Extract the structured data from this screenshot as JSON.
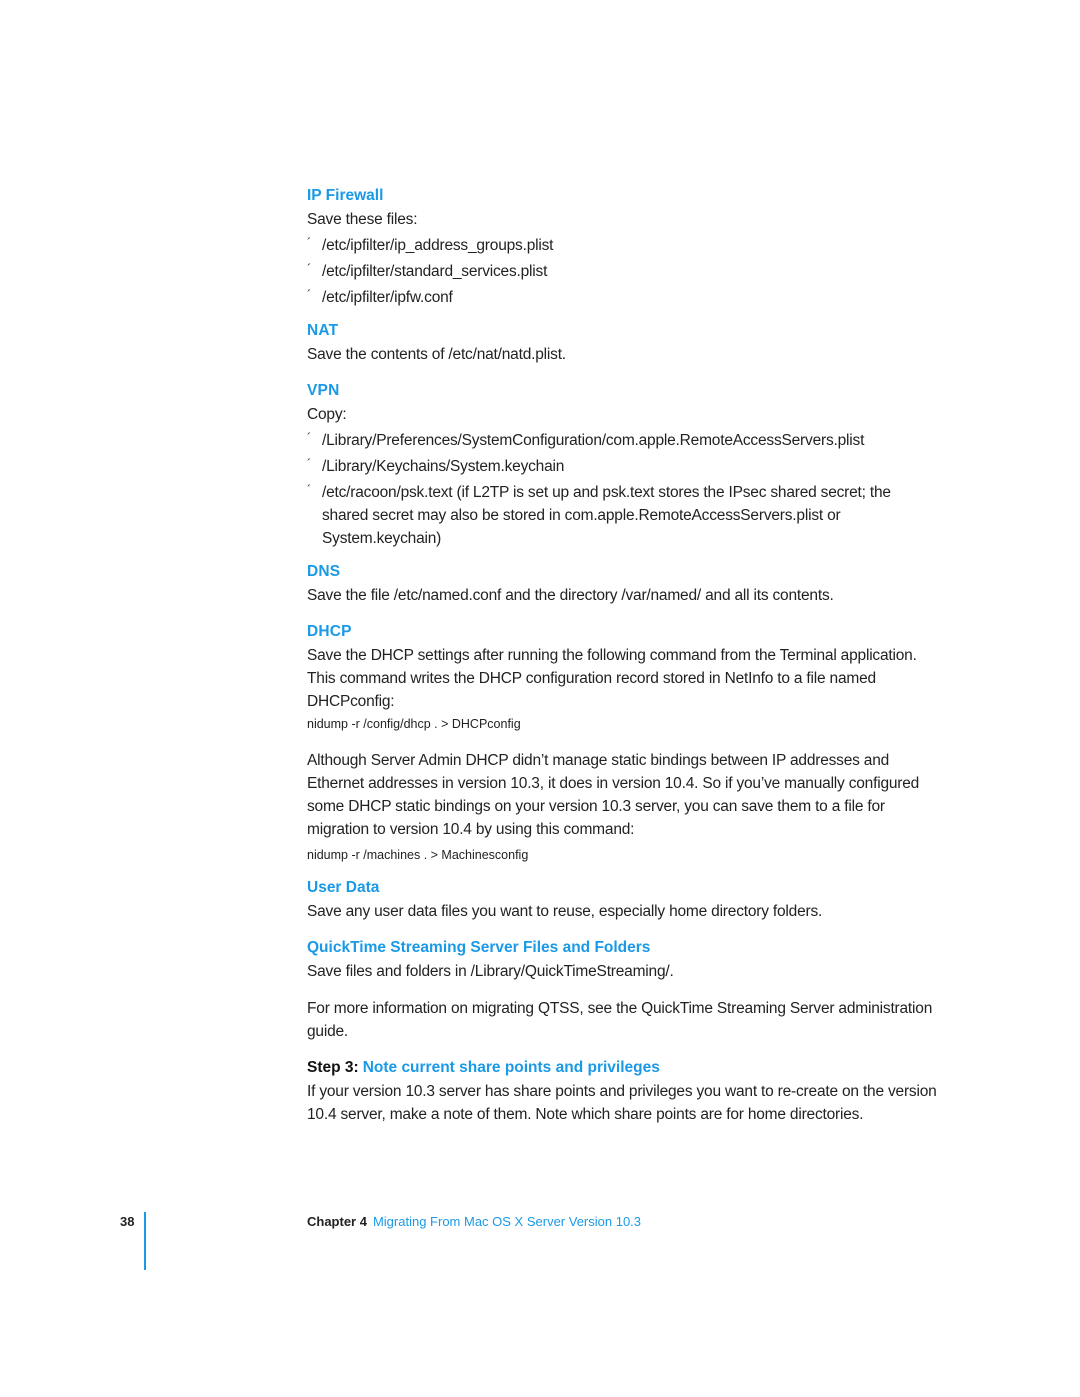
{
  "sections": {
    "ip_firewall": {
      "heading": "IP Firewall",
      "intro": "Save these files:",
      "items": [
        "/etc/ipfilter/ip_address_groups.plist",
        "/etc/ipfilter/standard_services.plist",
        "/etc/ipfilter/ipfw.conf"
      ]
    },
    "nat": {
      "heading": "NAT",
      "body": "Save the contents of /etc/nat/natd.plist."
    },
    "vpn": {
      "heading": "VPN",
      "intro": "Copy:",
      "items": [
        "/Library/Preferences/SystemConfiguration/com.apple.RemoteAccessServers.plist",
        "/Library/Keychains/System.keychain",
        "/etc/racoon/psk.text (if L2TP is set up and psk.text stores the IPsec shared secret; the shared secret may also be stored in com.apple.RemoteAccessServers.plist or System.keychain)"
      ]
    },
    "dns": {
      "heading": "DNS",
      "body": "Save the file /etc/named.conf and the directory /var/named/ and all its contents."
    },
    "dhcp": {
      "heading": "DHCP",
      "body": "Save the DHCP settings after running the following command from the Terminal application. This command writes the DHCP configuration record stored in NetInfo to a file named DHCPconfig:",
      "command1": "nidump -r /config/dhcp . > DHCPconfig",
      "body2": "Although Server Admin DHCP didn’t manage static bindings between IP addresses and Ethernet addresses in version 10.3, it does in version 10.4. So if you’ve manually configured some DHCP static bindings on your version 10.3 server, you can save them to a file for migration to version 10.4 by using this command:",
      "command2": "nidump -r /machines . > Machinesconfig"
    },
    "user_data": {
      "heading": "User Data",
      "body": "Save any user data files you want to reuse, especially home directory folders."
    },
    "qtss": {
      "heading": "QuickTime Streaming Server Files and Folders",
      "body": "Save files and folders in /Library/QuickTimeStreaming/.",
      "body2": "For more information on migrating QTSS, see the QuickTime Streaming Server administration guide."
    },
    "step3": {
      "label": "Step 3:",
      "title": "Note current share points and privileges",
      "body": "If your version 10.3 server has share points and privileges you want to re-create on the version 10.4 server, make a note of them. Note which share points are for home directories."
    }
  },
  "bullet_glyph": "´",
  "footer": {
    "page_number": "38",
    "chapter_label": "Chapter 4",
    "chapter_title": "Migrating From Mac OS X Server Version 10.3"
  },
  "colors": {
    "accent": "#1a9ae6",
    "text": "#222222"
  }
}
